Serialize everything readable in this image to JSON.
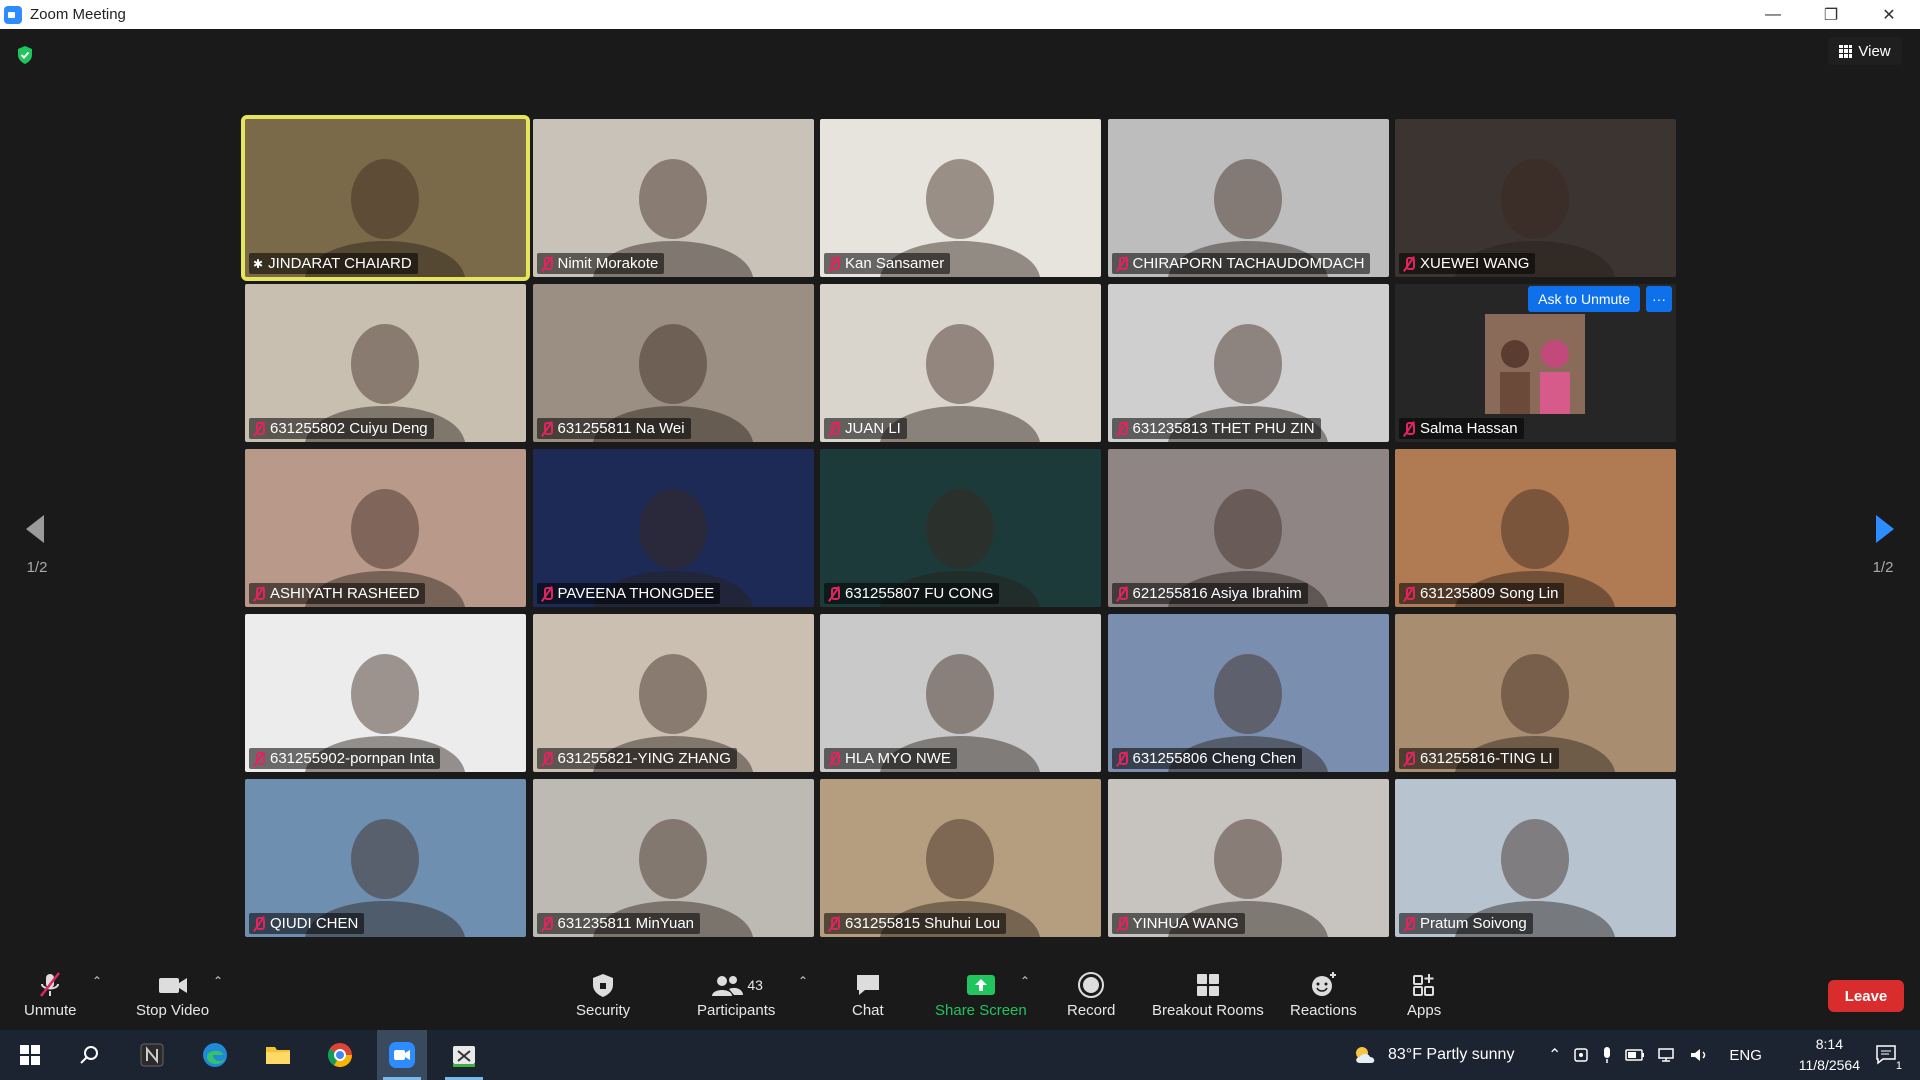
{
  "window": {
    "title": "Zoom Meeting"
  },
  "top": {
    "view_label": "View"
  },
  "pagination": {
    "left": "1/2",
    "right": "1/2"
  },
  "participants": [
    {
      "name": "JINDARAT CHAIARD",
      "bg": "#7a6a4a",
      "active": true
    },
    {
      "name": "Nimit Morakote",
      "bg": "#c9c2b8"
    },
    {
      "name": "Kan Sansamer",
      "bg": "#e7e3dd"
    },
    {
      "name": "CHIRAPORN TACHAUDOMDACH",
      "bg": "#bdbdbd"
    },
    {
      "name": "XUEWEI WANG",
      "bg": "#3b3430"
    },
    {
      "name": "631255802 Cuiyu Deng",
      "bg": "#c8bfb1"
    },
    {
      "name": "631255811 Na Wei",
      "bg": "#9a8f82"
    },
    {
      "name": "JUAN LI",
      "bg": "#d9d4cc"
    },
    {
      "name": "631235813 THET PHU ZIN",
      "bg": "#cfcfcf"
    },
    {
      "name": "Salma Hassan",
      "bg": "#262626",
      "ask_unmute": true
    },
    {
      "name": "ASHIYATH RASHEED",
      "bg": "#b99a8a"
    },
    {
      "name": "PAVEENA THONGDEE",
      "bg": "#1c2a55"
    },
    {
      "name": "631255807 FU CONG",
      "bg": "#1d3a3a"
    },
    {
      "name": "621255816 Asiya Ibrahim",
      "bg": "#8f8585"
    },
    {
      "name": "631235809 Song Lin",
      "bg": "#b07a52"
    },
    {
      "name": "631255902-pornpan Inta",
      "bg": "#ececec"
    },
    {
      "name": "631255821-YING ZHANG",
      "bg": "#cbbfb2"
    },
    {
      "name": "HLA MYO NWE",
      "bg": "#c9c9c9"
    },
    {
      "name": "631255806 Cheng Chen",
      "bg": "#7a8fb0"
    },
    {
      "name": "631255816-TING LI",
      "bg": "#a88d70"
    },
    {
      "name": "QIUDI CHEN",
      "bg": "#6f8fb0"
    },
    {
      "name": "631235811 MinYuan",
      "bg": "#bdbab3"
    },
    {
      "name": "631255815 Shuhui Lou",
      "bg": "#b59d7f"
    },
    {
      "name": "YINHUA WANG",
      "bg": "#c7c4c0"
    },
    {
      "name": "Pratum Soivong",
      "bg": "#b7c3cf"
    }
  ],
  "ask_unmute_label": "Ask to Unmute",
  "more_label": "···",
  "toolbar": {
    "unmute": "Unmute",
    "stop_video": "Stop Video",
    "security": "Security",
    "participants": "Participants",
    "participants_count": "43",
    "chat": "Chat",
    "share_screen": "Share Screen",
    "record": "Record",
    "breakout_rooms": "Breakout Rooms",
    "reactions": "Reactions",
    "apps": "Apps",
    "leave": "Leave"
  },
  "taskbar": {
    "weather": "83°F  Partly sunny",
    "lang": "ENG",
    "time": "8:14",
    "date": "11/8/2564",
    "notifications": "1"
  },
  "colors": {
    "accent_blue": "#0e71eb",
    "share_green": "#21c55d",
    "leave_red": "#d92d2d",
    "active_border": "#e6e65a",
    "muted_red": "#e0245e"
  }
}
